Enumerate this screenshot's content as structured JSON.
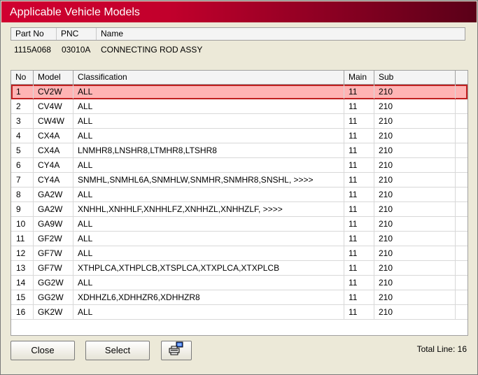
{
  "window": {
    "title": "Applicable Vehicle Models"
  },
  "part": {
    "headers": {
      "part_no": "Part No",
      "pnc": "PNC",
      "name": "Name"
    },
    "values": {
      "part_no": "1115A068",
      "pnc": "03010A",
      "name": "CONNECTING ROD ASSY"
    }
  },
  "grid": {
    "columns": {
      "no": "No",
      "model": "Model",
      "classification": "Classification",
      "main": "Main",
      "sub": "Sub"
    },
    "selected_row": 0,
    "rows": [
      {
        "no": "1",
        "model": "CV2W",
        "classification": "ALL",
        "main": "11",
        "sub": "210"
      },
      {
        "no": "2",
        "model": "CV4W",
        "classification": "ALL",
        "main": "11",
        "sub": "210"
      },
      {
        "no": "3",
        "model": "CW4W",
        "classification": "ALL",
        "main": "11",
        "sub": "210"
      },
      {
        "no": "4",
        "model": "CX4A",
        "classification": "ALL",
        "main": "11",
        "sub": "210"
      },
      {
        "no": "5",
        "model": "CX4A",
        "classification": "LNMHR8,LNSHR8,LTMHR8,LTSHR8",
        "main": "11",
        "sub": "210"
      },
      {
        "no": "6",
        "model": "CY4A",
        "classification": "ALL",
        "main": "11",
        "sub": "210"
      },
      {
        "no": "7",
        "model": "CY4A",
        "classification": "SNMHL,SNMHL6A,SNMHLW,SNMHR,SNMHR8,SNSHL,  >>>>",
        "main": "11",
        "sub": "210"
      },
      {
        "no": "8",
        "model": "GA2W",
        "classification": "ALL",
        "main": "11",
        "sub": "210"
      },
      {
        "no": "9",
        "model": "GA2W",
        "classification": "XNHHL,XNHHLF,XNHHLFZ,XNHHZL,XNHHZLF,  >>>>",
        "main": "11",
        "sub": "210"
      },
      {
        "no": "10",
        "model": "GA9W",
        "classification": "ALL",
        "main": "11",
        "sub": "210"
      },
      {
        "no": "11",
        "model": "GF2W",
        "classification": "ALL",
        "main": "11",
        "sub": "210"
      },
      {
        "no": "12",
        "model": "GF7W",
        "classification": "ALL",
        "main": "11",
        "sub": "210"
      },
      {
        "no": "13",
        "model": "GF7W",
        "classification": "XTHPLCA,XTHPLCB,XTSPLCA,XTXPLCA,XTXPLCB",
        "main": "11",
        "sub": "210"
      },
      {
        "no": "14",
        "model": "GG2W",
        "classification": "ALL",
        "main": "11",
        "sub": "210"
      },
      {
        "no": "15",
        "model": "GG2W",
        "classification": "XDHHZL6,XDHHZR6,XDHHZR8",
        "main": "11",
        "sub": "210"
      },
      {
        "no": "16",
        "model": "GK2W",
        "classification": "ALL",
        "main": "11",
        "sub": "210"
      }
    ]
  },
  "footer": {
    "close_label": "Close",
    "select_label": "Select",
    "print_icon": "printer-icon",
    "total_line": "Total Line: 16"
  },
  "colors": {
    "title_gradient_start": "#d00030",
    "title_gradient_end": "#5a0018",
    "selected_row_fill": "#ffb4b4",
    "selected_row_border": "#c02020"
  }
}
